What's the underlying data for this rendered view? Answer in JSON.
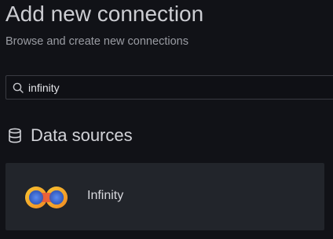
{
  "header": {
    "title": "Add new connection",
    "subtitle": "Browse and create new connections"
  },
  "search": {
    "value": "infinity",
    "icon": "search-icon"
  },
  "section": {
    "title": "Data sources",
    "icon": "database-icon"
  },
  "results": [
    {
      "label": "Infinity",
      "logo": "infinity-logo",
      "colors": {
        "ring_outer": "#f5a623",
        "ring_inner": "#3b6fd6"
      }
    }
  ],
  "colors": {
    "background": "#111217",
    "card": "#22252b",
    "border": "#3a3b42"
  }
}
